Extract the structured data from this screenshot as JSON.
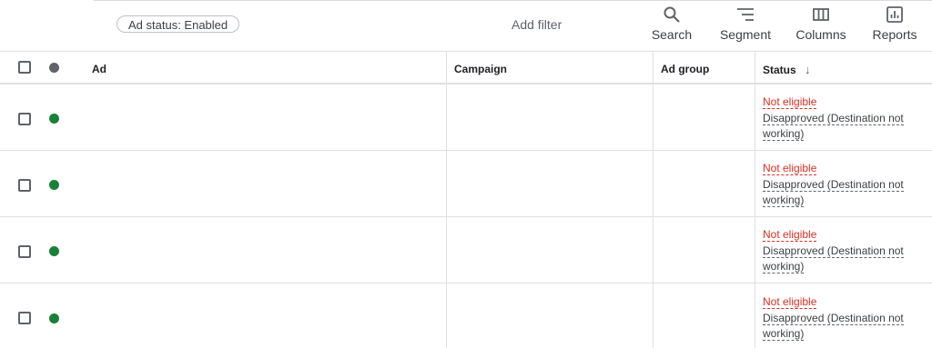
{
  "filter_chip": "Ad status: Enabled",
  "add_filter": "Add filter",
  "tools": {
    "search": "Search",
    "segment": "Segment",
    "columns": "Columns",
    "reports": "Reports"
  },
  "columns": {
    "ad": "Ad",
    "campaign": "Campaign",
    "ad_group": "Ad group",
    "status": "Status",
    "sort_indicator": "↓"
  },
  "colors": {
    "enabled_dot": "#188038",
    "header_dot": "#5f6368",
    "not_eligible": "#d93025"
  },
  "rows": [
    {
      "status": "Not eligible",
      "reason_1": "Disapproved (Destination not",
      "reason_2": "working)"
    },
    {
      "status": "Not eligible",
      "reason_1": "Disapproved (Destination not",
      "reason_2": "working)"
    },
    {
      "status": "Not eligible",
      "reason_1": "Disapproved (Destination not",
      "reason_2": "working)"
    },
    {
      "status": "Not eligible",
      "reason_1": "Disapproved (Destination not",
      "reason_2": "working)"
    }
  ]
}
